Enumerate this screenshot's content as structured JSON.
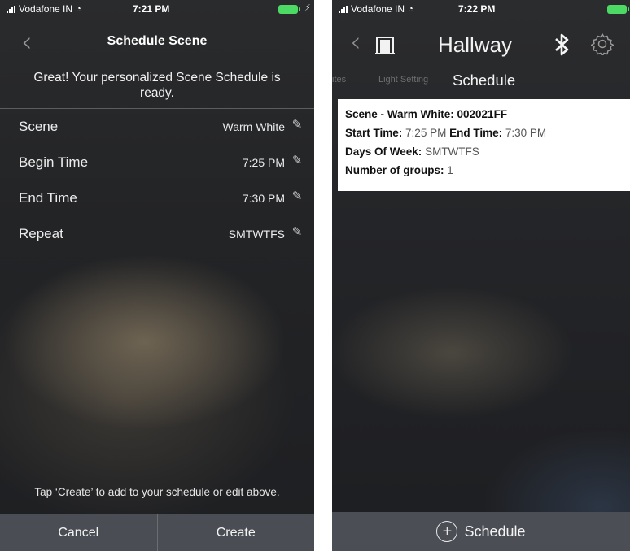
{
  "left": {
    "status": {
      "carrier": "Vodafone IN",
      "time": "7:21 PM"
    },
    "nav": {
      "back": "‹",
      "title": "Schedule Scene"
    },
    "banner": "Great! Your personalized Scene Schedule is ready.",
    "rows": [
      {
        "label": "Scene",
        "value": "Warm White"
      },
      {
        "label": "Begin Time",
        "value": "7:25 PM"
      },
      {
        "label": "End Time",
        "value": "7:30 PM"
      },
      {
        "label": "Repeat",
        "value": "SMTWTFS"
      }
    ],
    "hint": "Tap ‘Create’ to add to your schedule or edit above.",
    "buttons": {
      "cancel": "Cancel",
      "create": "Create"
    }
  },
  "right": {
    "status": {
      "carrier": "Vodafone IN",
      "time": "7:22 PM"
    },
    "nav": {
      "back": "‹",
      "title": "Hallway"
    },
    "tabs": [
      {
        "label": "ites"
      },
      {
        "label": "Light Setting"
      },
      {
        "label": "Schedule"
      }
    ],
    "card": {
      "scene_label": "Scene - Warm White: 002021FF",
      "start_label": "Start Time:",
      "start_value": "7:25 PM",
      "end_label": "End Time:",
      "end_value": "7:30 PM",
      "days_label": "Days Of Week:",
      "days_value": "SMTWTFS",
      "groups_label": "Number of groups:",
      "groups_value": "1"
    },
    "fab_label": "Schedule"
  },
  "colors": {
    "battery": "#4cd964",
    "bar": "#4a4d53",
    "card": "#ffffff"
  },
  "icons": [
    "signal-icon",
    "wifi-icon",
    "battery-icon",
    "charging-icon",
    "back-chevron-icon",
    "pencil-icon",
    "door-icon",
    "bluetooth-icon",
    "gear-icon",
    "plus-circle-icon"
  ]
}
